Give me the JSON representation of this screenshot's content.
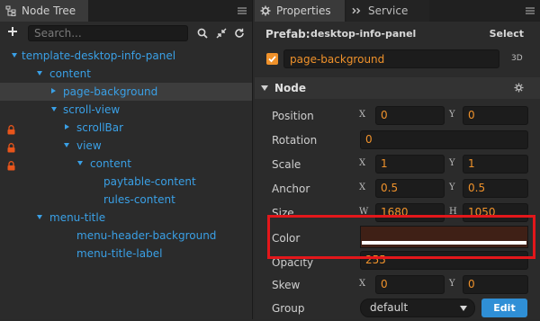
{
  "node_tree": {
    "tab_title": "Node Tree",
    "search_placeholder": "Search...",
    "items": [
      {
        "label": "template-desktop-info-panel",
        "expanded": true
      },
      {
        "label": "content",
        "expanded": true
      },
      {
        "label": "page-background",
        "selected": true
      },
      {
        "label": "scroll-view",
        "expanded": true
      },
      {
        "label": "scrollBar",
        "locked": true
      },
      {
        "label": "view",
        "expanded": true,
        "locked": true
      },
      {
        "label": "content",
        "expanded": true,
        "locked": true
      },
      {
        "label": "paytable-content"
      },
      {
        "label": "rules-content"
      },
      {
        "label": "menu-title",
        "expanded": true
      },
      {
        "label": "menu-header-background"
      },
      {
        "label": "menu-title-label"
      }
    ]
  },
  "properties": {
    "tab_title": "Properties",
    "service_tab_title": "Service",
    "prefab_label": "Prefab:",
    "prefab_name": "desktop-info-panel",
    "select_label": "Select",
    "node_name": "page-background",
    "tag_3d": "3D",
    "section_title": "Node",
    "position": {
      "label": "Position",
      "x_axis": "X",
      "x": "0",
      "y_axis": "Y",
      "y": "0"
    },
    "rotation": {
      "label": "Rotation",
      "value": "0"
    },
    "scale": {
      "label": "Scale",
      "x_axis": "X",
      "x": "1",
      "y_axis": "Y",
      "y": "1"
    },
    "anchor": {
      "label": "Anchor",
      "x_axis": "X",
      "x": "0.5",
      "y_axis": "Y",
      "y": "0.5"
    },
    "size": {
      "label": "Size",
      "w_axis": "W",
      "w": "1680",
      "h_axis": "H",
      "h": "1050"
    },
    "color": {
      "label": "Color",
      "value": "#3f2016"
    },
    "opacity": {
      "label": "Opacity",
      "value": "255"
    },
    "skew": {
      "label": "Skew",
      "x_axis": "X",
      "x": "0",
      "y_axis": "Y",
      "y": "0"
    },
    "group": {
      "label": "Group",
      "value": "default",
      "edit_label": "Edit"
    }
  },
  "colors": {
    "accent": "#f0922b",
    "tree_text": "#3aa0e6",
    "lock": "#e8551b",
    "highlight": "#e3171b",
    "edit_button": "#2f8fd6"
  }
}
